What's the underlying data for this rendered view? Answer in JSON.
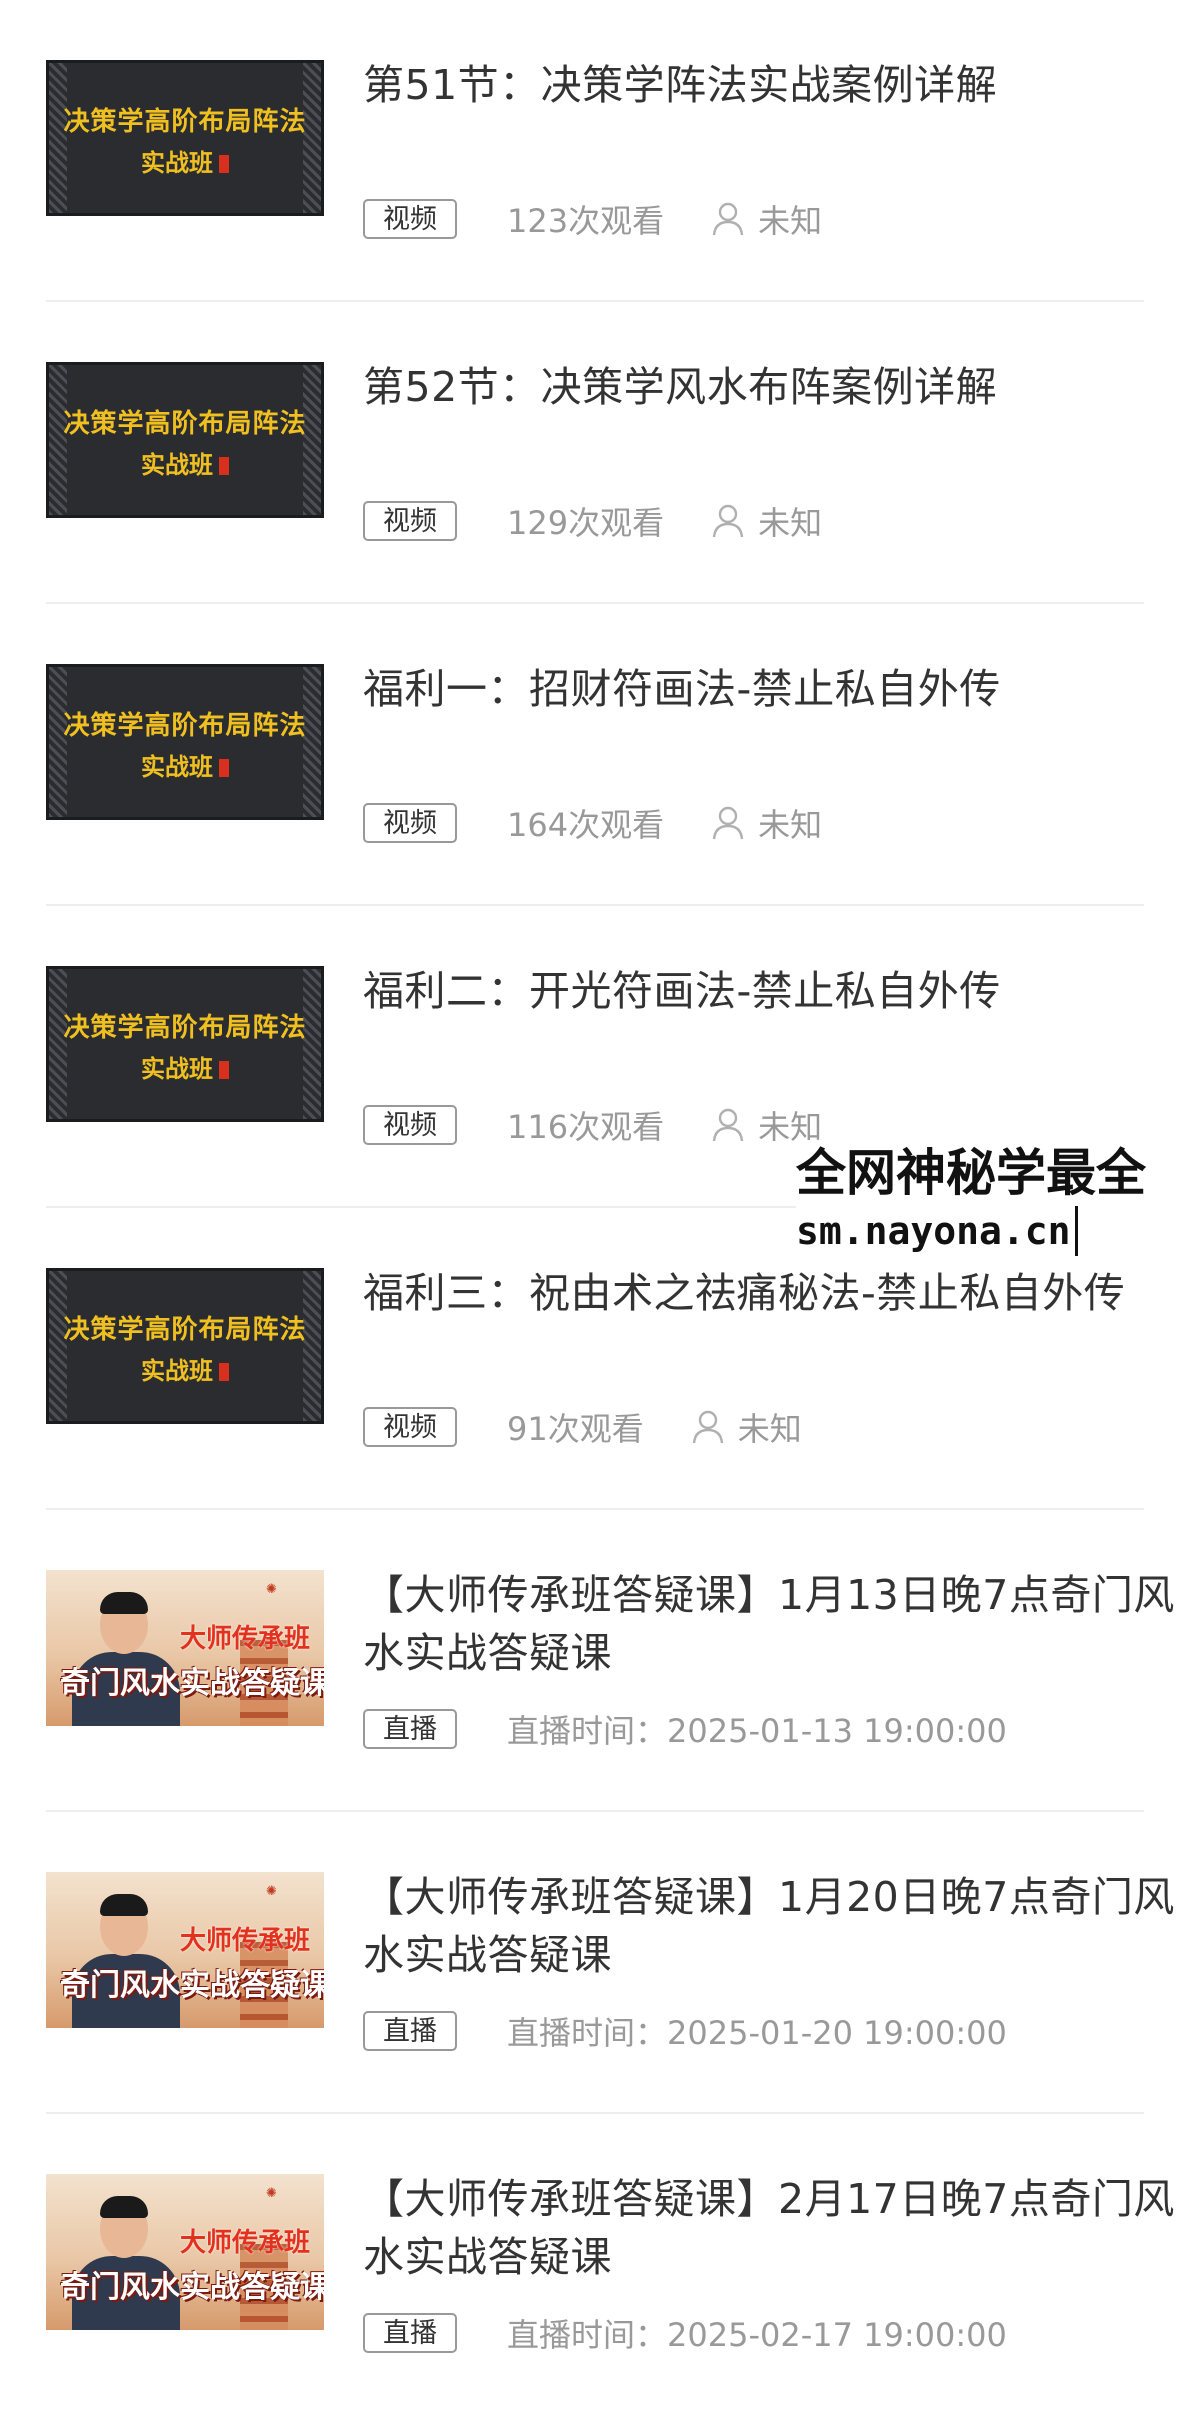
{
  "items": [
    {
      "thumb_line1": "决策学高阶布局阵法",
      "thumb_line2": "实战班",
      "title": "第51节：决策学阵法实战案例详解",
      "tag": "视频",
      "views": "123次观看",
      "author": "未知"
    },
    {
      "thumb_line1": "决策学高阶布局阵法",
      "thumb_line2": "实战班",
      "title": "第52节：决策学风水布阵案例详解",
      "tag": "视频",
      "views": "129次观看",
      "author": "未知"
    },
    {
      "thumb_line1": "决策学高阶布局阵法",
      "thumb_line2": "实战班",
      "title": "福利一：招财符画法-禁止私自外传",
      "tag": "视频",
      "views": "164次观看",
      "author": "未知"
    },
    {
      "thumb_line1": "决策学高阶布局阵法",
      "thumb_line2": "实战班",
      "title": "福利二：开光符画法-禁止私自外传",
      "tag": "视频",
      "views": "116次观看",
      "author": "未知"
    },
    {
      "thumb_line1": "决策学高阶布局阵法",
      "thumb_line2": "实战班",
      "title": "福利三：祝由术之祛痛秘法-禁止私自外传",
      "tag": "视频",
      "views": "91次观看",
      "author": "未知"
    },
    {
      "thumb_line1": "大师传承班",
      "thumb_line2": "奇门风水实战答疑课",
      "title": "【大师传承班答疑课】1月13日晚7点奇门风水实战答疑课",
      "tag": "直播",
      "live_time": "直播时间：2025-01-13 19:00:00"
    },
    {
      "thumb_line1": "大师传承班",
      "thumb_line2": "奇门风水实战答疑课",
      "title": "【大师传承班答疑课】1月20日晚7点奇门风水实战答疑课",
      "tag": "直播",
      "live_time": "直播时间：2025-01-20 19:00:00"
    },
    {
      "thumb_line1": "大师传承班",
      "thumb_line2": "奇门风水实战答疑课",
      "title": "【大师传承班答疑课】2月17日晚7点奇门风水实战答疑课",
      "tag": "直播",
      "live_time": "直播时间：2025-02-17 19:00:00"
    }
  ],
  "watermark": {
    "line1": "全网神秘学最全",
    "line2": "sm.nayona.cn"
  },
  "colors": {
    "title": "#333333",
    "meta": "#999999",
    "divider": "#eeeeee",
    "thumb_gold": "#f0c020",
    "thumb_red": "#e2311d"
  }
}
